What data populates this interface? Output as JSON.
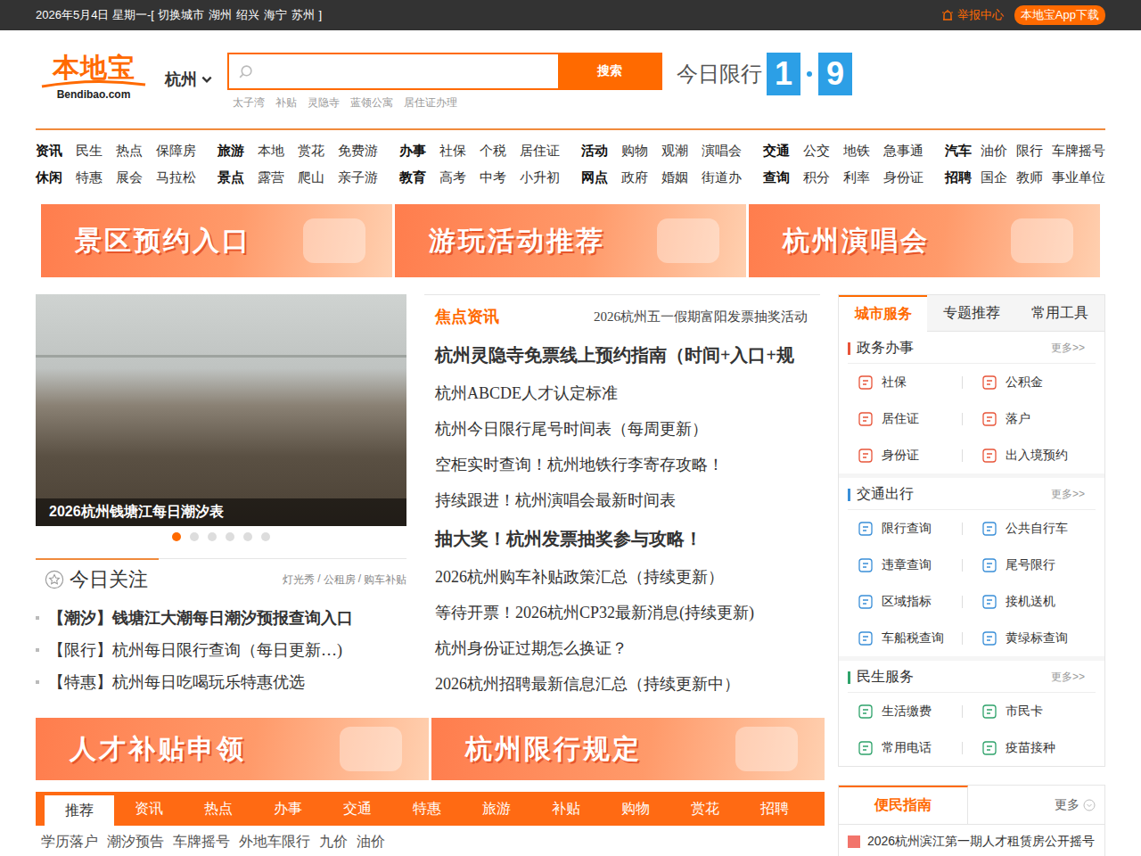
{
  "topbar": {
    "date": "2026年5月4日 星期一-[ 切换城市",
    "cities": [
      "湖州",
      "绍兴",
      "海宁",
      "苏州"
    ],
    "tail": "]",
    "report": "举报中心",
    "app": "本地宝App下载"
  },
  "header": {
    "logo": "本地宝",
    "logo_domain": "Bendibao.com",
    "city": "杭州",
    "search_button": "搜索",
    "hot_words": [
      "太子湾",
      "补贴",
      "灵隐寺",
      "蓝领公寓",
      "居住证办理"
    ],
    "limit_label": "今日限行",
    "limit_digits": [
      "1",
      "9"
    ]
  },
  "nav": [
    [
      [
        "资讯",
        "民生",
        "热点",
        "保障房"
      ],
      [
        "休闲",
        "特惠",
        "展会",
        "马拉松"
      ]
    ],
    [
      [
        "旅游",
        "本地",
        "赏花",
        "免费游"
      ],
      [
        "景点",
        "露营",
        "爬山",
        "亲子游"
      ]
    ],
    [
      [
        "办事",
        "社保",
        "个税",
        "居住证"
      ],
      [
        "教育",
        "高考",
        "中考",
        "小升初"
      ]
    ],
    [
      [
        "活动",
        "购物",
        "观潮",
        "演唱会"
      ],
      [
        "网点",
        "政府",
        "婚姻",
        "街道办"
      ]
    ],
    [
      [
        "交通",
        "公交",
        "地铁",
        "急事通"
      ],
      [
        "查询",
        "积分",
        "利率",
        "身份证"
      ]
    ],
    [
      [
        "汽车",
        "油价",
        "限行",
        "车牌摇号"
      ],
      [
        "招聘",
        "国企",
        "教师",
        "事业单位"
      ]
    ]
  ],
  "banners_top": [
    "景区预约入口",
    "游玩活动推荐",
    "杭州演唱会"
  ],
  "slideshow": {
    "caption": "2026杭州钱塘江每日潮汐表",
    "dots": [
      {
        "selected": true
      },
      {
        "selected": false
      },
      {
        "selected": false
      },
      {
        "selected": false
      },
      {
        "selected": false
      },
      {
        "selected": false
      }
    ]
  },
  "today": {
    "title": "今日关注",
    "links": [
      "灯光秀",
      "公租房",
      "购车补贴"
    ],
    "separator": "/",
    "items": [
      {
        "text": "【潮汐】钱塘江大潮每日潮汐预报查询入口",
        "bold": true
      },
      {
        "text": "【限行】杭州每日限行查询（每日更新…)",
        "bold": false
      },
      {
        "text": "【特惠】杭州每日吃喝玩乐特惠优选",
        "bold": false
      }
    ]
  },
  "focus": {
    "title": "焦点资讯",
    "ticker": "2026杭州五一假期富阳发票抽奖活动",
    "items": [
      {
        "text": "杭州灵隐寺免票线上预约指南（时间+入口+规",
        "bold": true
      },
      {
        "text": "杭州ABCDE人才认定标准",
        "bold": false
      },
      {
        "text": "杭州今日限行尾号时间表（每周更新）",
        "bold": false
      },
      {
        "text": "空柜实时查询！杭州地铁行李寄存攻略！",
        "bold": false
      },
      {
        "text": "持续跟进！杭州演唱会最新时间表",
        "bold": false
      },
      {
        "text": "抽大奖！杭州发票抽奖参与攻略！",
        "bold": true
      },
      {
        "text": "2026杭州购车补贴政策汇总（持续更新）",
        "bold": false
      },
      {
        "text": "等待开票！2026杭州CP32最新消息(持续更新)",
        "bold": false
      },
      {
        "text": "杭州身份证过期怎么换证？",
        "bold": false
      },
      {
        "text": "2026杭州招聘最新信息汇总（持续更新中）",
        "bold": false
      }
    ]
  },
  "banners_mid": [
    "人才补贴申领",
    "杭州限行规定"
  ],
  "tabs": [
    {
      "label": "推荐",
      "selected": true
    },
    {
      "label": "资讯",
      "selected": false
    },
    {
      "label": "热点",
      "selected": false
    },
    {
      "label": "办事",
      "selected": false
    },
    {
      "label": "交通",
      "selected": false
    },
    {
      "label": "特惠",
      "selected": false
    },
    {
      "label": "旅游",
      "selected": false
    },
    {
      "label": "补贴",
      "selected": false
    },
    {
      "label": "购物",
      "selected": false
    },
    {
      "label": "赏花",
      "selected": false
    },
    {
      "label": "招聘",
      "selected": false
    }
  ],
  "sublinks": [
    "学历落户",
    "潮汐预告",
    "车牌摇号",
    "外地车限行",
    "九价",
    "油价"
  ],
  "service": {
    "tabs": [
      {
        "label": "城市服务",
        "selected": true
      },
      {
        "label": "专题推荐",
        "selected": false
      },
      {
        "label": "常用工具",
        "selected": false
      }
    ],
    "sections": [
      {
        "title": "政务办事",
        "more": "更多>>",
        "color": "#e8553a",
        "items": [
          "社保",
          "公积金",
          "居住证",
          "落户",
          "身份证",
          "出入境预约"
        ]
      },
      {
        "title": "交通出行",
        "more": "更多>>",
        "color": "#3a8fd8",
        "items": [
          "限行查询",
          "公共自行车",
          "违章查询",
          "尾号限行",
          "区域指标",
          "接机送机",
          "车船税查询",
          "黄绿标查询"
        ]
      },
      {
        "title": "民生服务",
        "more": "更多>>",
        "color": "#2fa36b",
        "items": [
          "生活缴费",
          "市民卡",
          "常用电话",
          "疫苗接种"
        ]
      }
    ]
  },
  "guide": {
    "title": "便民指南",
    "more": "更多",
    "items": [
      "2026杭州滨江第一期人才租赁房公开摇号"
    ]
  }
}
